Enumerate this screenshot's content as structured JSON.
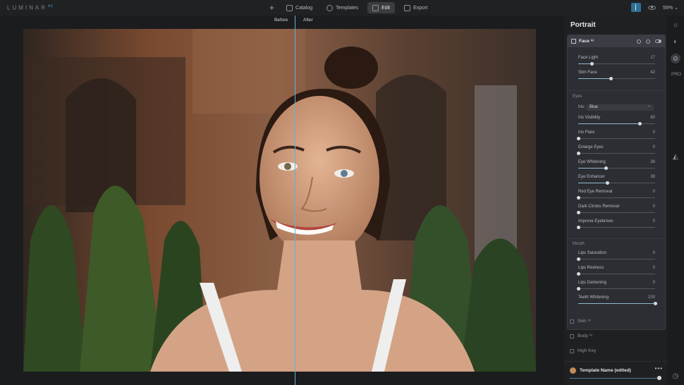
{
  "app": {
    "logo": "LUMINAR",
    "logo_version": "4.1"
  },
  "nav": {
    "add": "+",
    "catalog": "Catalog",
    "templates": "Templates",
    "edit": "Edit",
    "export": "Export"
  },
  "top_right": {
    "zoom": "56%"
  },
  "compare": {
    "before": "Before",
    "after": "After"
  },
  "panel": {
    "title": "Portrait",
    "card_title": "Face ᴬᴵ",
    "sliders_face": [
      {
        "label": "Face Light",
        "value": "17",
        "fraction": 0.17
      },
      {
        "label": "Slim Face",
        "value": "42",
        "fraction": 0.42
      }
    ],
    "eyes_label": "Eyes",
    "iris": {
      "label": "Iris:",
      "value": "Blue"
    },
    "sliders_eyes": [
      {
        "label": "Iris Visibility",
        "value": "80",
        "fraction": 0.8
      },
      {
        "label": "Iris Flare",
        "value": "0",
        "fraction": 0
      },
      {
        "label": "Enlarge Eyes",
        "value": "0",
        "fraction": 0
      },
      {
        "label": "Eye Whitening",
        "value": "36",
        "fraction": 0.36
      },
      {
        "label": "Eye Enhancer",
        "value": "38",
        "fraction": 0.38
      },
      {
        "label": "Red Eye Removal",
        "value": "0",
        "fraction": 0
      },
      {
        "label": "Dark Circles Removal",
        "value": "0",
        "fraction": 0
      },
      {
        "label": "Improve Eyebrows",
        "value": "0",
        "fraction": 0
      }
    ],
    "mouth_label": "Mouth",
    "sliders_mouth": [
      {
        "label": "Lips Saturation",
        "value": "0",
        "fraction": 0
      },
      {
        "label": "Lips Redness",
        "value": "0",
        "fraction": 0
      },
      {
        "label": "Lips Darkening",
        "value": "0",
        "fraction": 0
      },
      {
        "label": "Teeth Whitening",
        "value": "100",
        "fraction": 1.0
      }
    ],
    "collapsed": [
      {
        "label": "Skin ᴬᴵ"
      },
      {
        "label": "Body ᴬᴵ"
      },
      {
        "label": "High Key"
      }
    ],
    "template": {
      "name": "Template Name (edited)",
      "more": "•••",
      "amount": 1.0
    }
  },
  "strip": {
    "pro": "PRO"
  },
  "colors": {
    "accent": "#5fb1dc",
    "panel": "#2c2e33",
    "background": "#1b1c1e"
  }
}
